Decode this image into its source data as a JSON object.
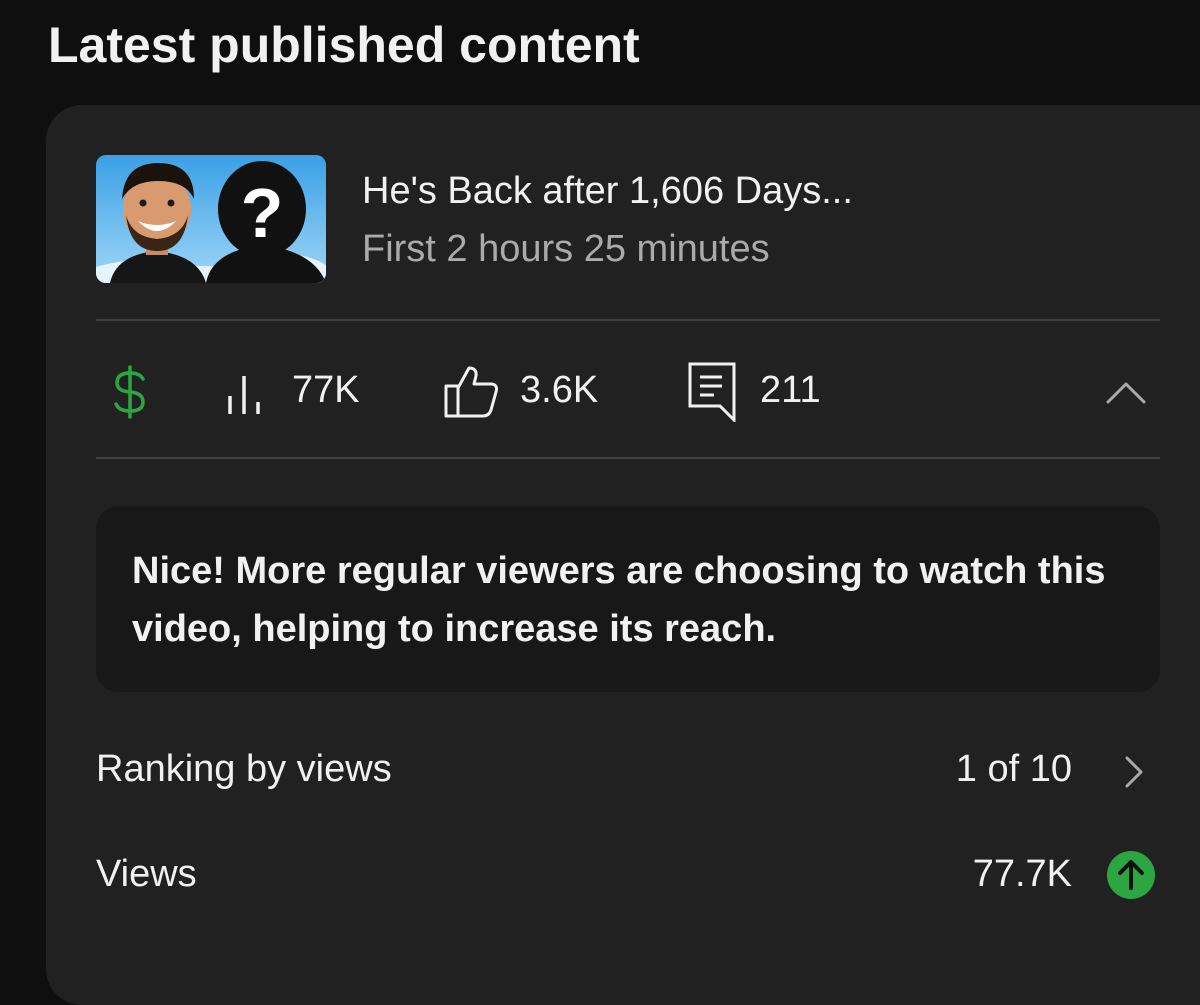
{
  "header": {
    "title": "Latest published content"
  },
  "video": {
    "title": "He's Back after 1,606 Days...",
    "subtitle": "First 2 hours 25 minutes",
    "thumbnail_mark": "?"
  },
  "stats": {
    "monetization_icon": "dollar-icon",
    "views_icon": "bar-chart-icon",
    "views": "77K",
    "likes_icon": "thumbs-up-icon",
    "likes": "3.6K",
    "comments_icon": "comment-icon",
    "comments": "211",
    "collapse_icon": "chevron-up-icon"
  },
  "insight": {
    "text": "Nice! More regular viewers are choosing to watch this video, helping to increase its reach."
  },
  "metrics": [
    {
      "label": "Ranking by views",
      "value": "1 of 10",
      "icon": "chevron-right-icon"
    },
    {
      "label": "Views",
      "value": "77.7K",
      "icon": "arrow-up-circle-icon"
    }
  ],
  "colors": {
    "background": "#0f0f0f",
    "card": "#212121",
    "insight_box": "#181818",
    "text_primary": "#f1f1f1",
    "text_secondary": "#aaaaaa",
    "divider": "#3f3f3f",
    "accent_green": "#2ba640"
  }
}
